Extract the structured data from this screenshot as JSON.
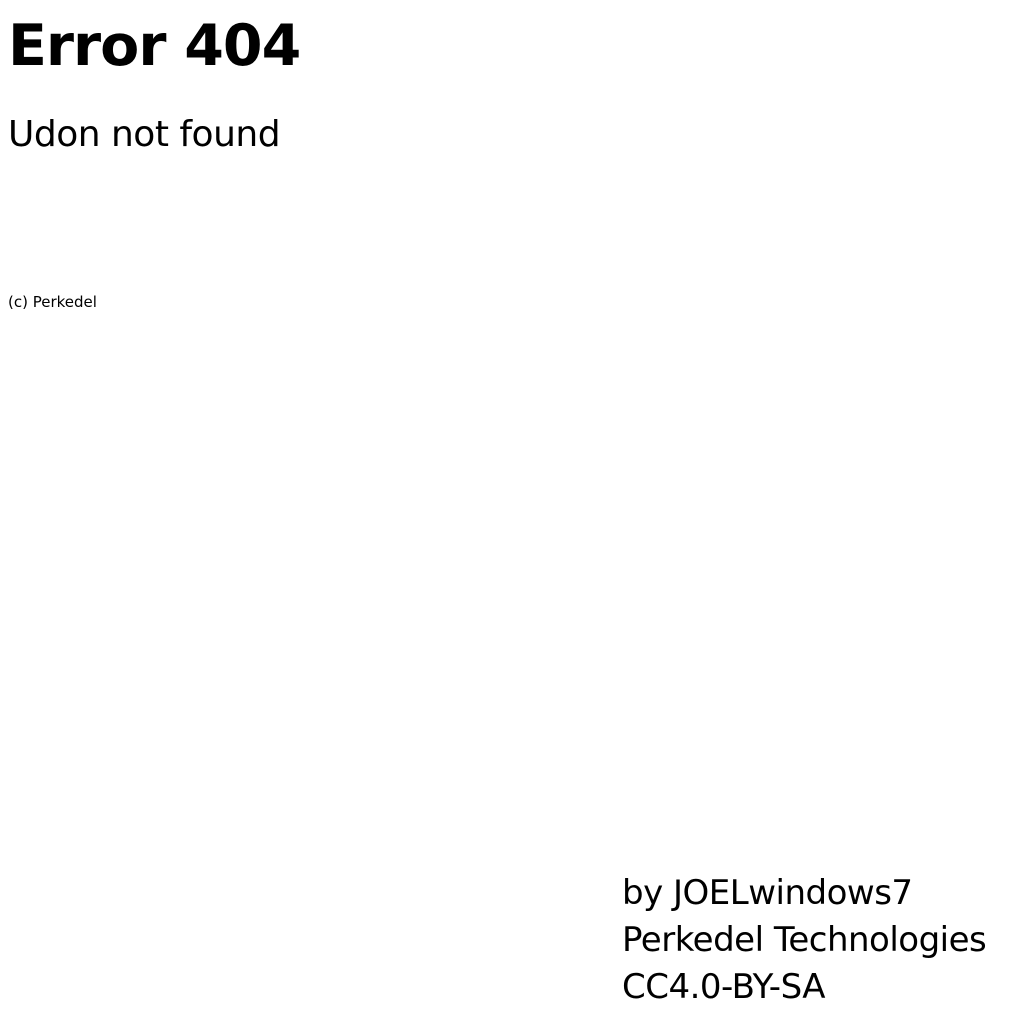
{
  "error": {
    "title": "Error 404",
    "message": "Udon not found",
    "copyright": "(c) Perkedel"
  },
  "credits": {
    "lines": [
      "by JOELwindows7",
      "Perkedel Technologies",
      "CC4.0-BY-SA"
    ]
  },
  "colors": {
    "background": "#ffffff",
    "text": "#000000"
  }
}
